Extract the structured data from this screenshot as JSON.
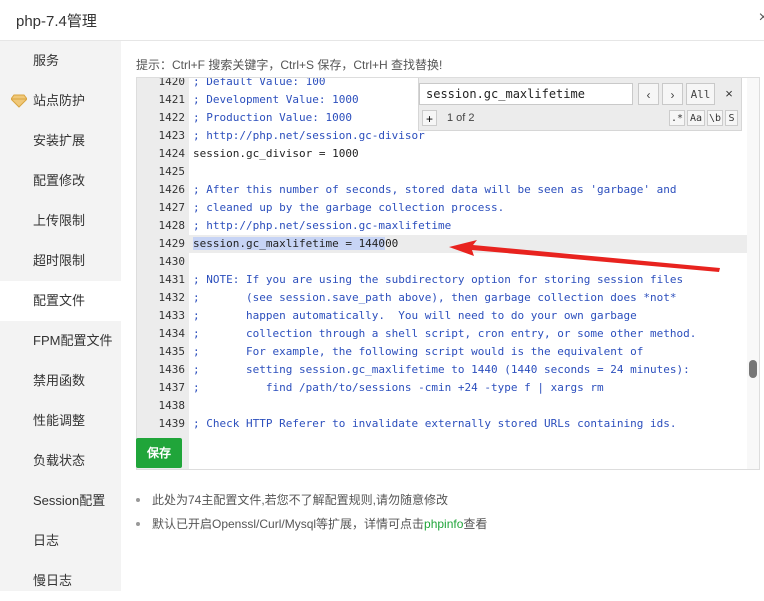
{
  "window": {
    "title": "php-7.4管理",
    "close": "×"
  },
  "sidebar": {
    "items": [
      {
        "label": "服务"
      },
      {
        "label": "站点防护"
      },
      {
        "label": "安装扩展"
      },
      {
        "label": "配置修改"
      },
      {
        "label": "上传限制"
      },
      {
        "label": "超时限制"
      },
      {
        "label": "配置文件",
        "active": true
      },
      {
        "label": "FPM配置文件"
      },
      {
        "label": "禁用函数"
      },
      {
        "label": "性能调整"
      },
      {
        "label": "负载状态"
      },
      {
        "label": "Session配置"
      },
      {
        "label": "日志"
      },
      {
        "label": "慢日志"
      }
    ]
  },
  "main": {
    "tip": "提示：Ctrl+F 搜索关键字，Ctrl+S 保存，Ctrl+H 查找替换!",
    "editor": {
      "lines": [
        {
          "n": "1420",
          "text": "; Default Value: 100",
          "type": "comment"
        },
        {
          "n": "1421",
          "text": "; Development Value: 1000",
          "type": "comment"
        },
        {
          "n": "1422",
          "text": "; Production Value: 1000",
          "type": "comment"
        },
        {
          "n": "1423",
          "text": "; http://php.net/session.gc-divisor",
          "type": "comment"
        },
        {
          "n": "1424",
          "text": "session.gc_divisor = 1000",
          "type": "plain"
        },
        {
          "n": "1425",
          "text": "",
          "type": "plain"
        },
        {
          "n": "1426",
          "text": "; After this number of seconds, stored data will be seen as 'garbage' and",
          "type": "comment"
        },
        {
          "n": "1427",
          "text": "; cleaned up by the garbage collection process.",
          "type": "comment"
        },
        {
          "n": "1428",
          "text": "; http://php.net/session.gc-maxlifetime",
          "type": "comment"
        },
        {
          "n": "1429",
          "text": "session.gc_maxlifetime = 144000",
          "type": "plain",
          "highlight": true
        },
        {
          "n": "1430",
          "text": "",
          "type": "plain"
        },
        {
          "n": "1431",
          "text": "; NOTE: If you are using the subdirectory option for storing session files",
          "type": "comment"
        },
        {
          "n": "1432",
          "text": ";       (see session.save_path above), then garbage collection does *not*",
          "type": "comment"
        },
        {
          "n": "1433",
          "text": ";       happen automatically.  You will need to do your own garbage",
          "type": "comment"
        },
        {
          "n": "1434",
          "text": ";       collection through a shell script, cron entry, or some other method.",
          "type": "comment"
        },
        {
          "n": "1435",
          "text": ";       For example, the following script would is the equivalent of",
          "type": "comment"
        },
        {
          "n": "1436",
          "text": ";       setting session.gc_maxlifetime to 1440 (1440 seconds = 24 minutes):",
          "type": "comment"
        },
        {
          "n": "1437",
          "text": ";          find /path/to/sessions -cmin +24 -type f | xargs rm",
          "type": "comment"
        },
        {
          "n": "1438",
          "text": "",
          "type": "plain"
        },
        {
          "n": "1439",
          "text": "; Check HTTP Referer to invalidate externally stored URLs containing ids.",
          "type": "comment"
        }
      ]
    },
    "search": {
      "query": "session.gc_maxlifetime",
      "prev": "‹",
      "next": "›",
      "all": "All",
      "close": "×",
      "plus": "+",
      "count": "1 of 2",
      "opt_regex": ".*",
      "opt_case": "Aa",
      "opt_word": "\\b",
      "opt_sel": "S"
    },
    "save_label": "保存",
    "notes": [
      {
        "text": "此处为74主配置文件,若您不了解配置规则,请勿随意修改"
      },
      {
        "text": "默认已开启Openssl/Curl/Mysql等扩展，详情可点击",
        "link": "phpinfo",
        "suffix": "查看"
      }
    ]
  },
  "colors": {
    "accent": "#20a53a",
    "arrow": "#e8231f",
    "comment": "#2c4fbd",
    "selection": "#c7d4f5"
  }
}
